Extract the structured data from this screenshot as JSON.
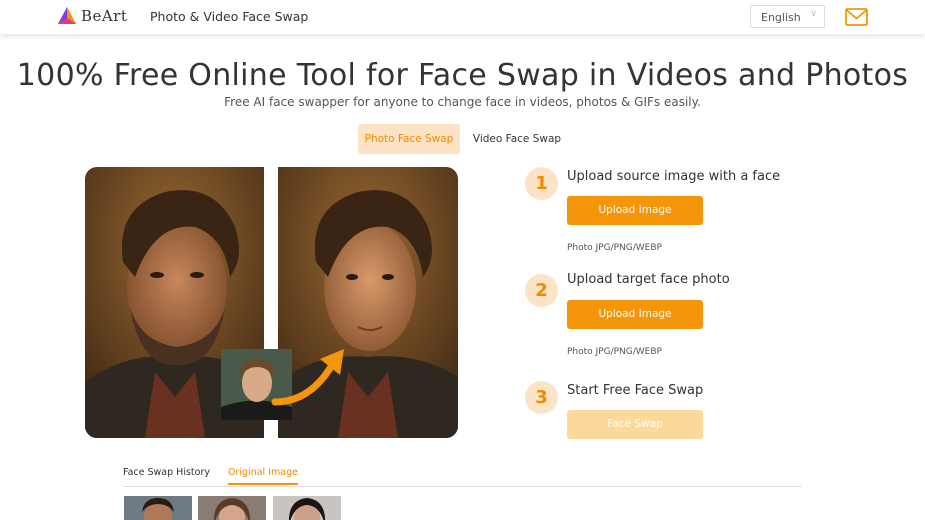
{
  "header": {
    "brand": "BeArt",
    "title": "Photo & Video Face Swap",
    "language": "English",
    "icons": {
      "logo": "beart-logo-icon",
      "mail": "mail-icon",
      "chevron": "chevron-down-icon"
    }
  },
  "hero": {
    "title": "100% Free Online Tool for Face Swap in Videos and Photos",
    "subtitle": "Free AI face swapper for anyone to change face in videos, photos & GIFs easily."
  },
  "mode_tabs": [
    {
      "label": "Photo Face Swap",
      "active": true
    },
    {
      "label": "Video Face Swap",
      "active": false
    }
  ],
  "steps": [
    {
      "number": "1",
      "title": "Upload source image with a face",
      "button": "Upload Image",
      "hint": "Photo JPG/PNG/WEBP"
    },
    {
      "number": "2",
      "title": "Upload target face photo",
      "button": "Upload Image",
      "hint": "Photo JPG/PNG/WEBP"
    },
    {
      "number": "3",
      "title": "Start Free Face Swap",
      "button": "Face Swap"
    }
  ],
  "bottom_tabs": [
    {
      "label": "Face Swap History",
      "active": false
    },
    {
      "label": "Original Image",
      "active": true
    }
  ],
  "colors": {
    "accent": "#f5950a",
    "accent_light": "#fde3c5",
    "accent_disabled": "#fcd99b",
    "text": "#333333"
  }
}
